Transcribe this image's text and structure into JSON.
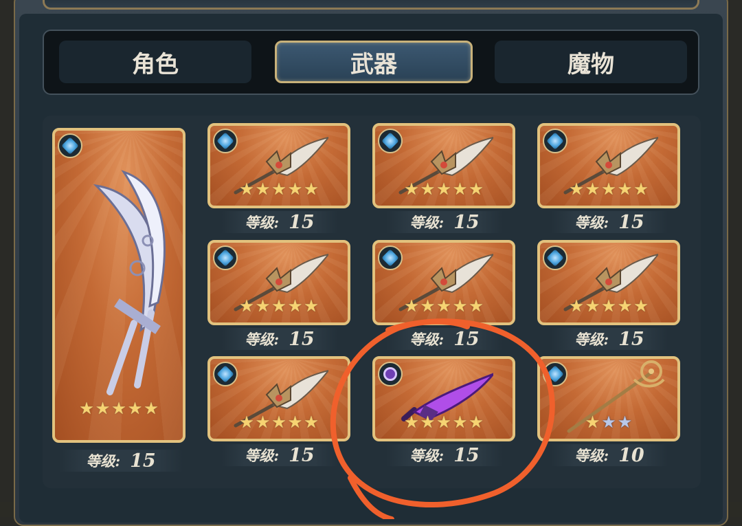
{
  "tabs": [
    {
      "label": "角色",
      "active": false
    },
    {
      "label": "武器",
      "active": true
    },
    {
      "label": "魔物",
      "active": false
    }
  ],
  "level_label": "等级:",
  "featured": {
    "element": "water",
    "stars": 5,
    "level": "15",
    "weapon_icon": "twin-scythe-icon"
  },
  "weapons": [
    {
      "element": "water",
      "stars": 5,
      "level": "15",
      "weapon_icon": "scythe-icon"
    },
    {
      "element": "water",
      "stars": 5,
      "level": "15",
      "weapon_icon": "scythe-icon"
    },
    {
      "element": "water",
      "stars": 5,
      "level": "15",
      "weapon_icon": "scythe-icon"
    },
    {
      "element": "water",
      "stars": 5,
      "level": "15",
      "weapon_icon": "scythe-icon"
    },
    {
      "element": "water",
      "stars": 5,
      "level": "15",
      "weapon_icon": "scythe-icon"
    },
    {
      "element": "water",
      "stars": 5,
      "level": "15",
      "weapon_icon": "scythe-icon"
    },
    {
      "element": "water",
      "stars": 5,
      "level": "15",
      "weapon_icon": "scythe-icon"
    },
    {
      "element": "void",
      "stars": 5,
      "level": "15",
      "weapon_icon": "purple-blade-icon",
      "highlighted": true
    },
    {
      "element": "water",
      "stars": 3,
      "gold_stars": 1,
      "level": "10",
      "weapon_icon": "staff-icon"
    }
  ],
  "colors": {
    "card_gold": "#e2c27e",
    "card_orange": "#c46a35",
    "star_gold": "#f6d372",
    "star_blue": "#b9c8e8",
    "annotation": "#f0602c"
  }
}
